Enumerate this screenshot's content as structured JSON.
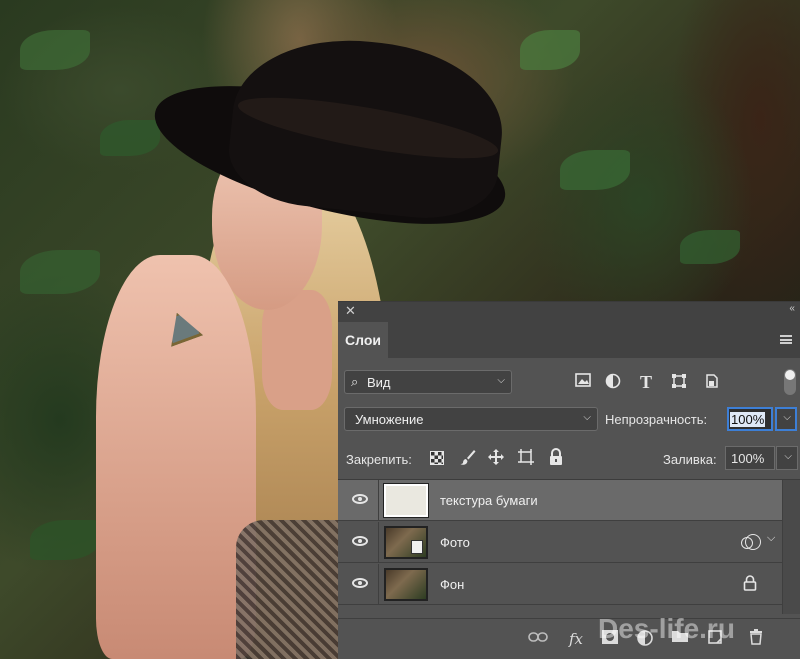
{
  "panel": {
    "tab_label": "Слои",
    "filter": {
      "label": "Вид",
      "search_icon": "search-icon"
    },
    "filter_icons": [
      "image-filter-icon",
      "adjustment-filter-icon",
      "type-filter-icon",
      "shape-filter-icon",
      "smart-object-filter-icon"
    ],
    "blend_mode": "Умножение",
    "opacity_label": "Непрозрачность:",
    "opacity_value": "100%",
    "lock_label": "Закрепить:",
    "fill_label": "Заливка:",
    "fill_value": "100%",
    "layers": [
      {
        "name": "текстура бумаги",
        "selected": true,
        "visible": true
      },
      {
        "name": "Фото",
        "selected": false,
        "visible": true,
        "smart_object": true
      },
      {
        "name": "Фон",
        "selected": false,
        "visible": true,
        "locked": true
      }
    ],
    "bottom_fx": "fx"
  },
  "watermark": "Des-life.ru",
  "colors": {
    "panel_bg": "#535353",
    "panel_dark": "#424242",
    "selected_row": "#6a6a6a",
    "focus_blue": "#3d7fd6"
  }
}
